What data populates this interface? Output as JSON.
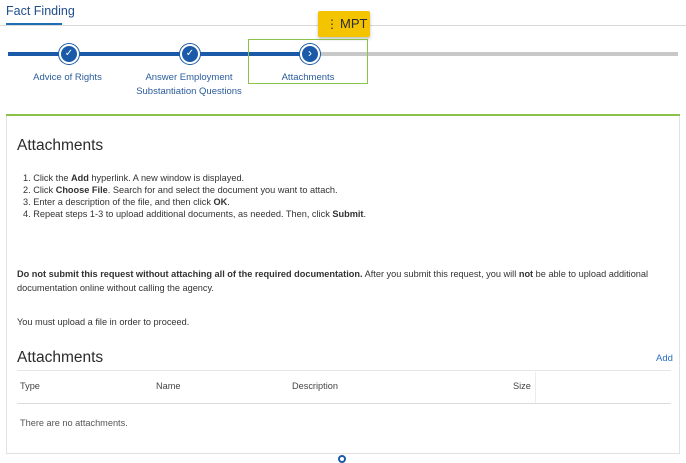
{
  "header": {
    "title": "Fact Finding"
  },
  "badge": {
    "dots": "⋮",
    "label": "MPT"
  },
  "progress": {
    "steps": [
      {
        "label": "Advice of Rights",
        "state": "complete"
      },
      {
        "label": "Answer Employment",
        "label2": "Substantiation Questions",
        "state": "complete"
      },
      {
        "label": "Attachments",
        "state": "current"
      }
    ],
    "check_glyph": "✓",
    "current_glyph": "›"
  },
  "instructions": {
    "heading": "Attachments",
    "steps": [
      {
        "pre": "1. Click the ",
        "bold": "Add",
        "post": " hyperlink. A new window is displayed."
      },
      {
        "pre": "2. Click ",
        "bold": "Choose File",
        "post": ". Search for and select the document you want to attach."
      },
      {
        "pre": "3. Enter a description of the file, and then click ",
        "bold": "OK",
        "post": "."
      },
      {
        "pre": "4. Repeat steps 1-3 to upload additional documents, as needed. Then, click ",
        "bold": "Submit",
        "post": "."
      }
    ]
  },
  "warning": {
    "bold": "Do not submit this request without attaching all of the required documentation.",
    "text1": " After you submit this request, you will ",
    "bold2": "not",
    "text2": " be able to upload additional documentation online without calling the agency."
  },
  "must_upload": "You must upload a file in order to proceed.",
  "attachments_table": {
    "heading": "Attachments",
    "add_label": "Add",
    "columns": [
      "Type",
      "Name",
      "Description",
      "Size"
    ],
    "empty_text": "There are no attachments."
  },
  "colors": {
    "primary": "#1a5aa8",
    "accent_green": "#8bc34a",
    "badge_yellow": "#f5c400",
    "link": "#2a6fbf"
  }
}
